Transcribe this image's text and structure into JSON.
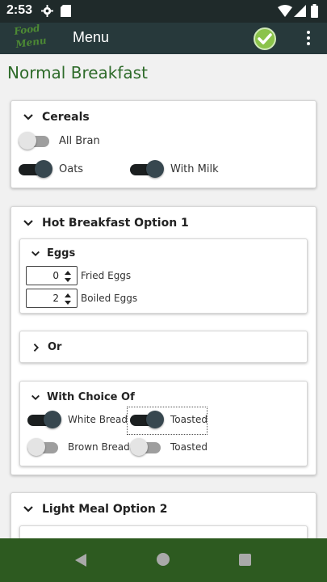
{
  "status_bar": {
    "time": "2:53"
  },
  "app_bar": {
    "title": "Menu",
    "logo_text": "Food Menu"
  },
  "page": {
    "title": "Normal Breakfast"
  },
  "cereals": {
    "title": "Cereals",
    "items": [
      {
        "label": "All Bran",
        "on": false
      },
      {
        "label": "Oats",
        "on": true
      },
      {
        "label": "With Milk",
        "on": true
      }
    ]
  },
  "hot_breakfast": {
    "title": "Hot Breakfast Option 1",
    "eggs": {
      "title": "Eggs",
      "items": [
        {
          "label": "Fried Eggs",
          "value": "0"
        },
        {
          "label": "Boiled Eggs",
          "value": "2"
        }
      ]
    },
    "or": {
      "title": "Or"
    },
    "choice": {
      "title": "With Choice Of",
      "items": [
        {
          "label": "White Bread",
          "on": true
        },
        {
          "label": "Toasted",
          "on": true
        },
        {
          "label": "Brown Bread",
          "on": false
        },
        {
          "label": "Toasted",
          "on": false
        }
      ]
    }
  },
  "light_meal": {
    "title": "Light Meal Option 2"
  },
  "colors": {
    "accent_green": "#2e6b2a",
    "app_bar": "#27393b",
    "nav_bar": "#2d5a20"
  }
}
